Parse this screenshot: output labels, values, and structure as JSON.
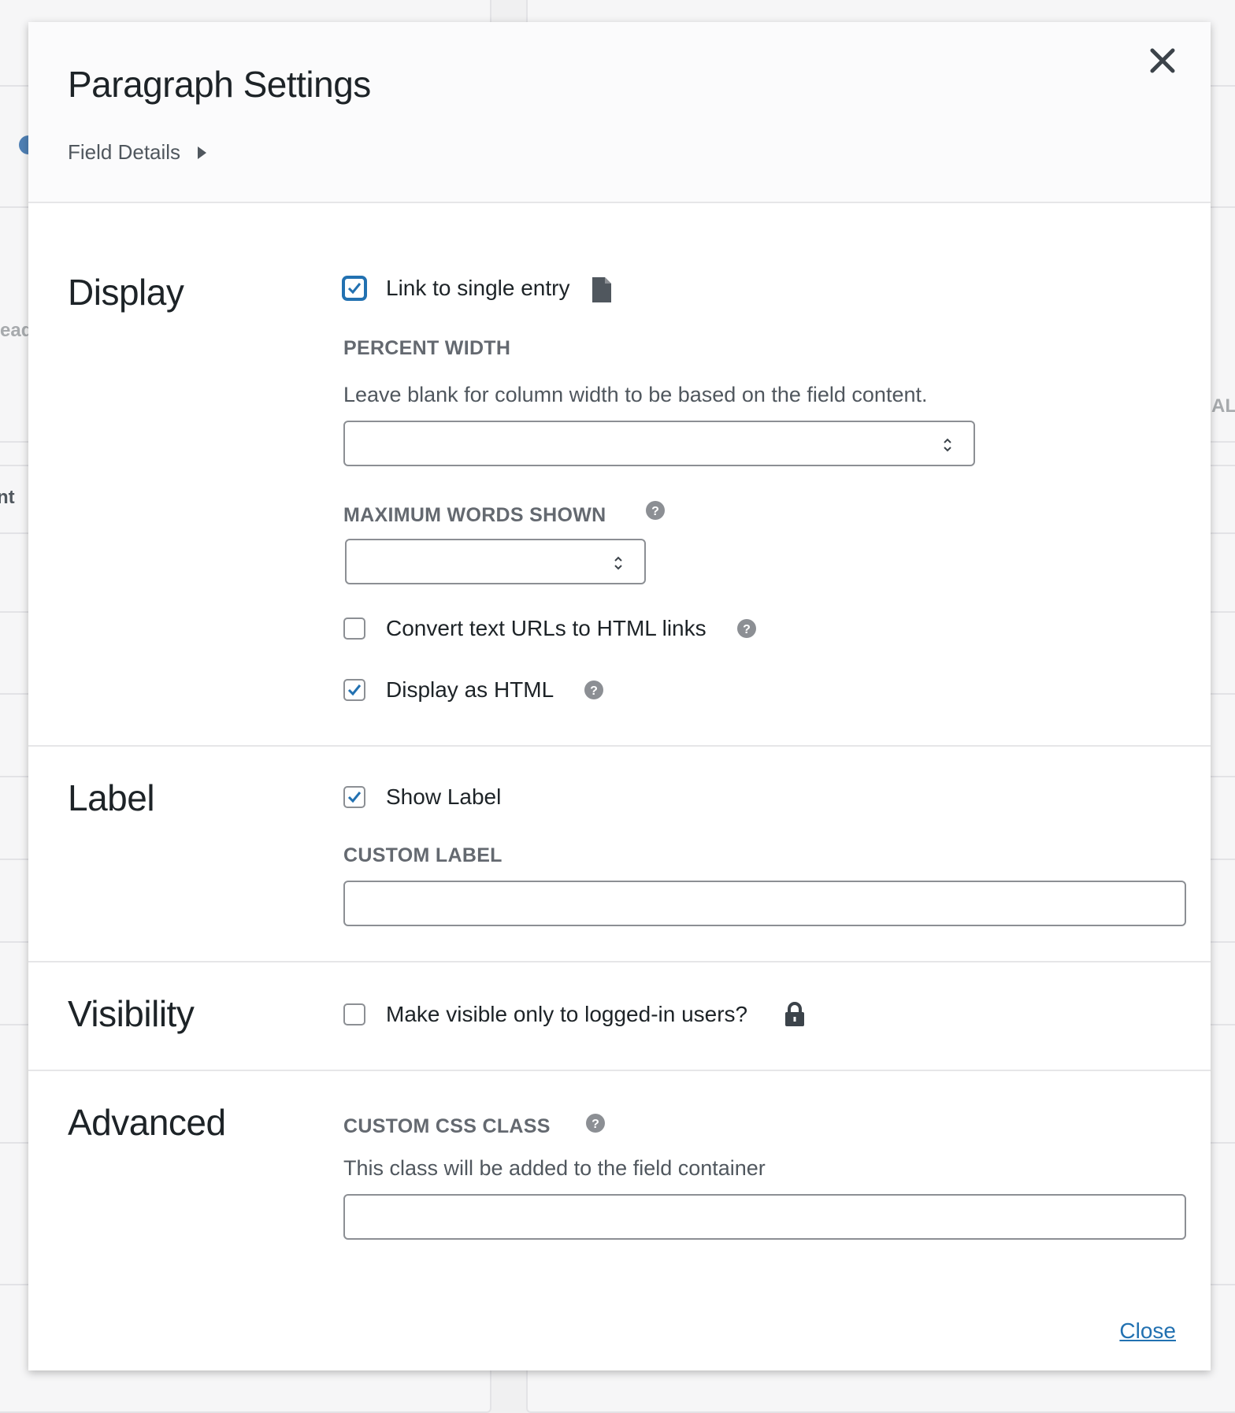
{
  "modal": {
    "title": "Paragraph Settings",
    "field_details_label": "Field Details",
    "close_link": "Close"
  },
  "sections": {
    "display": {
      "title": "Display",
      "link_single_entry": {
        "label": "Link to single entry",
        "checked": true
      },
      "percent_width": {
        "label": "Percent Width",
        "description": "Leave blank for column width to be based on the field content.",
        "value": ""
      },
      "max_words": {
        "label": "Maximum Words Shown",
        "value": ""
      },
      "convert_urls": {
        "label": "Convert text URLs to HTML links",
        "checked": false
      },
      "display_html": {
        "label": "Display as HTML",
        "checked": true
      }
    },
    "label": {
      "title": "Label",
      "show_label": {
        "label": "Show Label",
        "checked": true
      },
      "custom_label": {
        "label": "Custom Label",
        "value": ""
      }
    },
    "visibility": {
      "title": "Visibility",
      "logged_in_only": {
        "label": "Make visible only to logged-in users?",
        "checked": false
      }
    },
    "advanced": {
      "title": "Advanced",
      "css_class": {
        "label": "Custom CSS Class",
        "description": "This class will be added to the field container",
        "value": ""
      }
    }
  },
  "background": {
    "fragment_1": "ead",
    "fragment_2": "nt",
    "fragment_3": "AL"
  },
  "colors": {
    "accent": "#2271b1",
    "check": "#2271b1",
    "help_icon": "#8c8f94",
    "muted_text": "#646970"
  }
}
